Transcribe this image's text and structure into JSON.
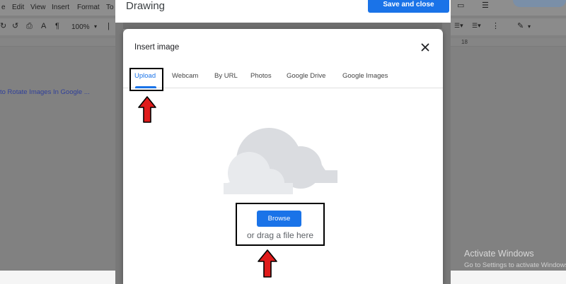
{
  "docs": {
    "menu": [
      "e",
      "Edit",
      "View",
      "Insert",
      "Format",
      "To"
    ],
    "toolbar": {
      "zoom": "100%"
    },
    "link_text": "to Rotate Images In Google ...",
    "ruler_label": "18"
  },
  "drawing": {
    "title": "Drawing",
    "save_close": "Save and close"
  },
  "modal": {
    "title": "Insert image",
    "tabs": [
      {
        "label": "Upload",
        "active": true
      },
      {
        "label": "Webcam",
        "active": false
      },
      {
        "label": "By URL",
        "active": false
      },
      {
        "label": "Photos",
        "active": false
      },
      {
        "label": "Google Drive",
        "active": false
      },
      {
        "label": "Google Images",
        "active": false
      }
    ],
    "browse_label": "Browse",
    "drag_text": "or drag a file here"
  },
  "overlay": {
    "activate_title": "Activate Windows",
    "activate_sub": "Go to Settings to activate Windows."
  },
  "colors": {
    "accent": "#1a73e8",
    "arrow_fill": "#e01b1b",
    "cloud": "#dadce0"
  }
}
